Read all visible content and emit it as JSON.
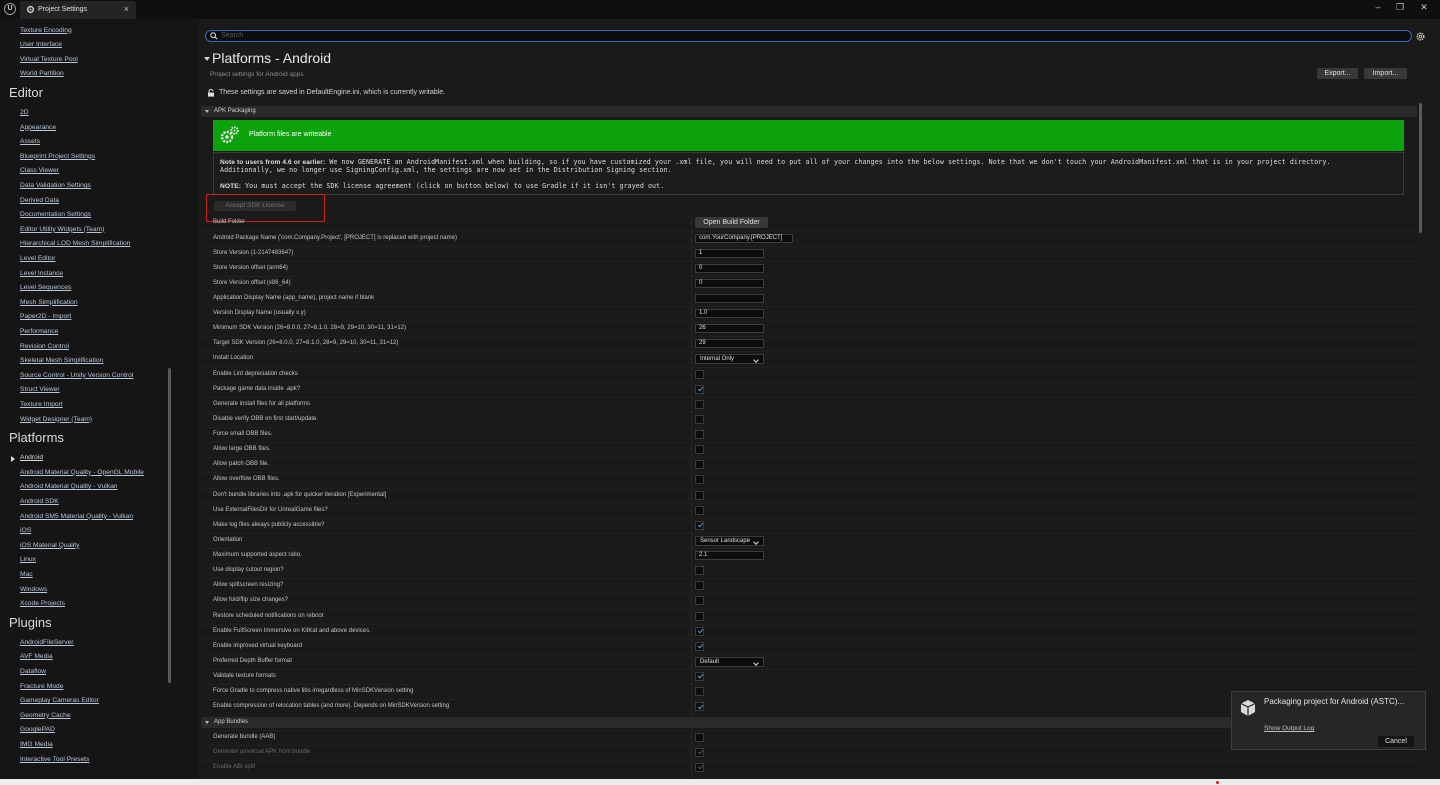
{
  "window": {
    "tab_title": "Project Settings",
    "tab_close": "×",
    "minimize": "–",
    "maximize": "❐",
    "close": "✕",
    "logo": "U"
  },
  "sidebar": {
    "top_items": [
      "Texture Encoding",
      "User Interface",
      "Virtual Texture Pool",
      "World Partition"
    ],
    "editor_heading": "Editor",
    "editor_items": [
      "2D",
      "Appearance",
      "Assets",
      "Blueprint Project Settings",
      "Class Viewer",
      "Data Validation Settings",
      "Derived Data",
      "Documentation Settings",
      "Editor Utility Widgets (Team)",
      "Hierarchical LOD Mesh Simplification",
      "Level Editor",
      "Level Instance",
      "Level Sequences",
      "Mesh Simplification",
      "Paper2D - Import",
      "Performance",
      "Revision Control",
      "Skeletal Mesh Simplification",
      "Source Control - Unity Version Control",
      "Struct Viewer",
      "Texture Import",
      "Widget Designer (Team)"
    ],
    "platforms_heading": "Platforms",
    "platform_items": [
      "Android",
      "Android Material Quality - OpenGL Mobile",
      "Android Material Quality - Vulkan",
      "Android SDK",
      "Android SM5 Material Quality - Vulkan",
      "iOS",
      "iOS Material Quality",
      "Linux",
      "Mac",
      "Windows",
      "Xcode Projects"
    ],
    "plugins_heading": "Plugins",
    "plugin_items": [
      "AndroidFileServer",
      "AVF Media",
      "Dataflow",
      "Fracture Mode",
      "Gameplay Cameras Editor",
      "Geometry Cache",
      "GooglePAD",
      "IMG Media",
      "Interactive Tool Presets"
    ]
  },
  "search": {
    "placeholder": "Search"
  },
  "header": {
    "title": "Platforms - Android",
    "subtitle": "Project settings for Android apps",
    "export_label": "Export...",
    "import_label": "Import...",
    "writable_note": "These settings are saved in DefaultEngine.ini, which is currently writable."
  },
  "apk": {
    "section_label": "APK Packaging",
    "banner_text": "Platform files are writeable",
    "note_bold": "Note to users from 4.6 or earlier:",
    "note_line1": " We now GENERATE an AndroidManifest.xml when building, so if you have customized your .xml file, you will need to put all of your changes into the below settings. Note that we don't touch your AndroidManifest.xml that is in your project directory.",
    "note_line2": "Additionally, we no longer use SigningConfig.xml, the settings are now set in the Distribution Signing section.",
    "note2_bold": "NOTE:",
    "note2_text": " You must accept the SDK license agreement (click on button below) to use Gradle if it isn't grayed out.",
    "accept_label": "Accept SDK License",
    "build_folder_label": "Build Folder",
    "open_build_folder": "Open Build Folder",
    "rows": [
      {
        "label": "Android Package Name ('com.Company.Project', [PROJECT] is replaced with project name)",
        "type": "text",
        "value": "com.YourCompany.[PROJECT]"
      },
      {
        "label": "Store Version (1-2147483647)",
        "type": "text",
        "value": "1"
      },
      {
        "label": "Store Version offset (arm64)",
        "type": "text",
        "value": "0"
      },
      {
        "label": "Store Version offset (x86_64)",
        "type": "text",
        "value": "0"
      },
      {
        "label": "Application Display Name (app_name), project name if blank",
        "type": "text",
        "value": ""
      },
      {
        "label": "Version Display Name (usually x.y)",
        "type": "text",
        "value": "1.0"
      },
      {
        "label": "Minimum SDK Version (26=8.0.0, 27=8.1.0, 28=9, 29=10, 30=11, 31=12)",
        "type": "text",
        "value": "26"
      },
      {
        "label": "Target SDK Version (26=8.0.0, 27=8.1.0, 28=9, 29=10, 30=11, 31=12)",
        "type": "text",
        "value": "29"
      },
      {
        "label": "Install Location",
        "type": "dropdown",
        "value": "Internal Only"
      },
      {
        "label": "Enable Lint depreciation checks",
        "type": "check",
        "checked": false
      },
      {
        "label": "Package game data inside .apk?",
        "type": "check",
        "checked": true
      },
      {
        "label": "Generate install files for all platforms",
        "type": "check",
        "checked": false
      },
      {
        "label": "Disable verify OBB on first start/update.",
        "type": "check",
        "checked": false
      },
      {
        "label": "Force small OBB files.",
        "type": "check",
        "checked": false
      },
      {
        "label": "Allow large OBB files.",
        "type": "check",
        "checked": false
      },
      {
        "label": "Allow patch OBB file.",
        "type": "check",
        "checked": false
      },
      {
        "label": "Allow overflow OBB files.",
        "type": "check",
        "checked": false
      },
      {
        "label": "Don't bundle libraries into .apk for quicker iteration [Experimental]",
        "type": "check",
        "checked": false
      },
      {
        "label": "Use ExternalFilesDir for UnrealGame files?",
        "type": "check",
        "checked": false
      },
      {
        "label": "Make log files always publicly accessible?",
        "type": "check",
        "checked": true
      },
      {
        "label": "Orientation",
        "type": "dropdown",
        "value": "Sensor Landscape"
      },
      {
        "label": "Maximum supported aspect ratio.",
        "type": "text",
        "value": "2.1"
      },
      {
        "label": "Use display cutout region?",
        "type": "check",
        "checked": false
      },
      {
        "label": "Allow splitscreen resizing?",
        "type": "check",
        "checked": false
      },
      {
        "label": "Allow fold/flip size changes?",
        "type": "check",
        "checked": false
      },
      {
        "label": "Restore scheduled notifications on reboot",
        "type": "check",
        "checked": false
      },
      {
        "label": "Enable FullScreen Immersive on KitKat and above devices.",
        "type": "check",
        "checked": true
      },
      {
        "label": "Enable improved virtual keyboard",
        "type": "check",
        "checked": true
      },
      {
        "label": "Preferred Depth Buffer format",
        "type": "dropdown",
        "value": "Default"
      },
      {
        "label": "Validate texture formats",
        "type": "check",
        "checked": true
      },
      {
        "label": "Force Gradle to compress native libs irregardless of MinSDKVersion setting",
        "type": "check",
        "checked": false
      },
      {
        "label": "Enable compression of relocation tables (and more). Depends on MinSDKVersion setting",
        "type": "check",
        "checked": true
      }
    ]
  },
  "bundles": {
    "section_label": "App Bundles",
    "rows": [
      {
        "label": "Generate bundle (AAB)",
        "type": "check",
        "checked": false,
        "dim": false
      },
      {
        "label": "Generate universal APK from bundle",
        "type": "check",
        "checked": true,
        "dim": true
      },
      {
        "label": "Enable ABI split",
        "type": "check",
        "checked": true,
        "dim": true
      }
    ]
  },
  "toast": {
    "title": "Packaging project for Android (ASTC)...",
    "link": "Show Output Log",
    "cancel": "Cancel"
  },
  "colors": {
    "banner_green": "#0ba20b",
    "highlight_red": "#d12020",
    "search_border": "#2a6fc6",
    "check_blue": "#5a9ee0"
  },
  "icons": [
    "unreal-logo-icon",
    "project-settings-icon",
    "search-icon",
    "gear-icon",
    "lock-icon",
    "platform-gears-icon",
    "packaging-box-icon"
  ]
}
